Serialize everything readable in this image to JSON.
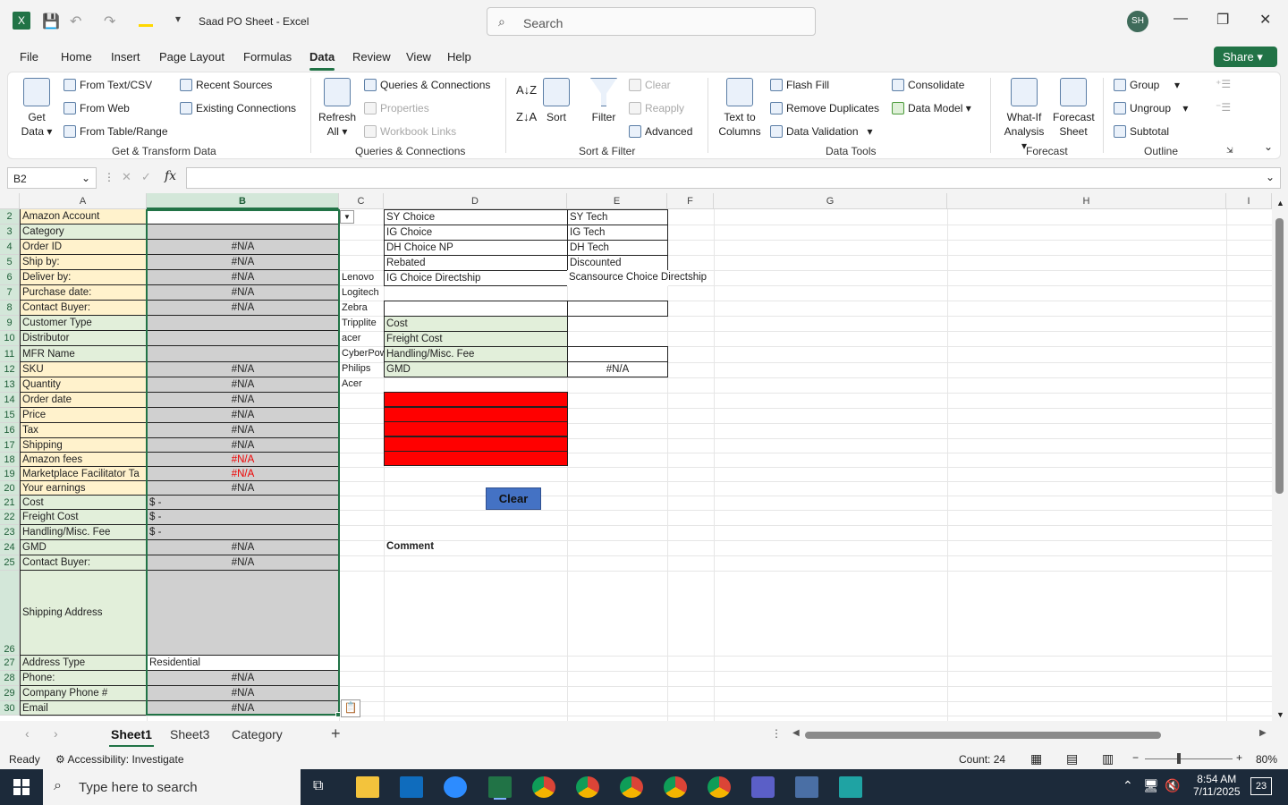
{
  "titlebar": {
    "title": "Saad PO Sheet  -  Excel",
    "search_placeholder": "Search",
    "avatar": "SH"
  },
  "menu": {
    "items": [
      "File",
      "Home",
      "Insert",
      "Page Layout",
      "Formulas",
      "Data",
      "Review",
      "View",
      "Help"
    ],
    "share": "Share"
  },
  "ribbon": {
    "get_data": "Get Data",
    "from_text": "From Text/CSV",
    "from_web": "From Web",
    "from_table": "From Table/Range",
    "recent_sources": "Recent Sources",
    "existing_connections": "Existing Connections",
    "refresh_all": "Refresh All",
    "queries_connections": "Queries & Connections",
    "properties": "Properties",
    "workbook_links": "Workbook Links",
    "sort_az": "A↓Z",
    "sort": "Sort",
    "filter": "Filter",
    "clear": "Clear",
    "reapply": "Reapply",
    "advanced": "Advanced",
    "text_to_columns": "Text to Columns",
    "flash_fill": "Flash Fill",
    "remove_duplicates": "Remove Duplicates",
    "data_validation": "Data Validation",
    "consolidate": "Consolidate",
    "data_model": "Data Model",
    "what_if": "What-If Analysis",
    "forecast_sheet": "Forecast Sheet",
    "group": "Group",
    "ungroup": "Ungroup",
    "subtotal": "Subtotal",
    "groups": [
      "Get & Transform Data",
      "Queries & Connections",
      "Sort & Filter",
      "Data Tools",
      "Forecast",
      "Outline"
    ]
  },
  "formula": {
    "namebox": "B2",
    "fx": "fx"
  },
  "columns": [
    "A",
    "B",
    "C",
    "D",
    "E",
    "F",
    "G",
    "H",
    "I"
  ],
  "rows": [
    {
      "n": "2",
      "a": "Amazon Account",
      "b": ""
    },
    {
      "n": "3",
      "a": "Category",
      "b": ""
    },
    {
      "n": "4",
      "a": "Order ID",
      "b": "#N/A"
    },
    {
      "n": "5",
      "a": "Ship by:",
      "b": "#N/A"
    },
    {
      "n": "6",
      "a": "Deliver by:",
      "b": "#N/A"
    },
    {
      "n": "7",
      "a": "Purchase date:",
      "b": "#N/A"
    },
    {
      "n": "8",
      "a": "Contact Buyer:",
      "b": "#N/A"
    },
    {
      "n": "9",
      "a": "Customer Type",
      "b": ""
    },
    {
      "n": "10",
      "a": "Distributor",
      "b": ""
    },
    {
      "n": "11",
      "a": "MFR Name",
      "b": ""
    },
    {
      "n": "12",
      "a": "SKU",
      "b": "#N/A"
    },
    {
      "n": "13",
      "a": "Quantity",
      "b": "#N/A"
    },
    {
      "n": "14",
      "a": "Order date",
      "b": "#N/A"
    },
    {
      "n": "15",
      "a": "Price",
      "b": "#N/A"
    },
    {
      "n": "16",
      "a": "Tax",
      "b": "#N/A"
    },
    {
      "n": "17",
      "a": "Shipping",
      "b": "#N/A"
    },
    {
      "n": "18",
      "a": "Amazon fees",
      "b": "#N/A"
    },
    {
      "n": "19",
      "a": "Marketplace Facilitator Ta",
      "b": "#N/A"
    },
    {
      "n": "20",
      "a": "Your earnings",
      "b": "#N/A"
    },
    {
      "n": "21",
      "a": "Cost",
      "b": "$                                          -"
    },
    {
      "n": "22",
      "a": "Freight Cost",
      "b": "$                                          -"
    },
    {
      "n": "23",
      "a": "Handling/Misc. Fee",
      "b": "$                                          -"
    },
    {
      "n": "24",
      "a": "GMD",
      "b": "#N/A"
    },
    {
      "n": "25",
      "a": "Contact Buyer:",
      "b": "#N/A"
    },
    {
      "n": "26",
      "a": "Shipping Address",
      "b": ""
    },
    {
      "n": "27",
      "a": "Address Type",
      "b": "Residential"
    },
    {
      "n": "28",
      "a": "Phone:",
      "b": "#N/A"
    },
    {
      "n": "29",
      "a": "Company Phone #",
      "b": "#N/A"
    },
    {
      "n": "30",
      "a": "Email",
      "b": "#N/A"
    }
  ],
  "col_c": [
    "Lenovo",
    "Logitech",
    "Zebra",
    "Tripplite",
    "acer",
    "CyberPow",
    "Philips",
    "Acer"
  ],
  "col_d": [
    "SY Choice",
    "IG Choice",
    "DH Choice NP",
    " Rebated",
    "IG Choice Directship"
  ],
  "col_e": [
    "SY Tech",
    "IG Tech",
    "DH Tech",
    " Discounted",
    "Scansource Choice Directship"
  ],
  "cost_labels": [
    "Cost",
    "Freight Cost",
    "Handling/Misc. Fee",
    "GMD"
  ],
  "gmd_value": "#N/A",
  "clear_button": "Clear",
  "comment_label": "Comment",
  "sheets": [
    "Sheet1",
    "Sheet3",
    "Category"
  ],
  "status": {
    "ready": "Ready",
    "accessibility": "Accessibility: Investigate",
    "count": "Count: 24",
    "zoom": "80%"
  },
  "taskbar": {
    "search": "Type here to search",
    "time": "8:54 AM",
    "date": "7/11/2025",
    "notif": "23"
  },
  "colors": {
    "accent": "#217346",
    "yellow": "#fff2cc",
    "green": "#e2efda",
    "gray": "#d0d0d0",
    "red": "#ff0000",
    "button": "#4472c4"
  }
}
